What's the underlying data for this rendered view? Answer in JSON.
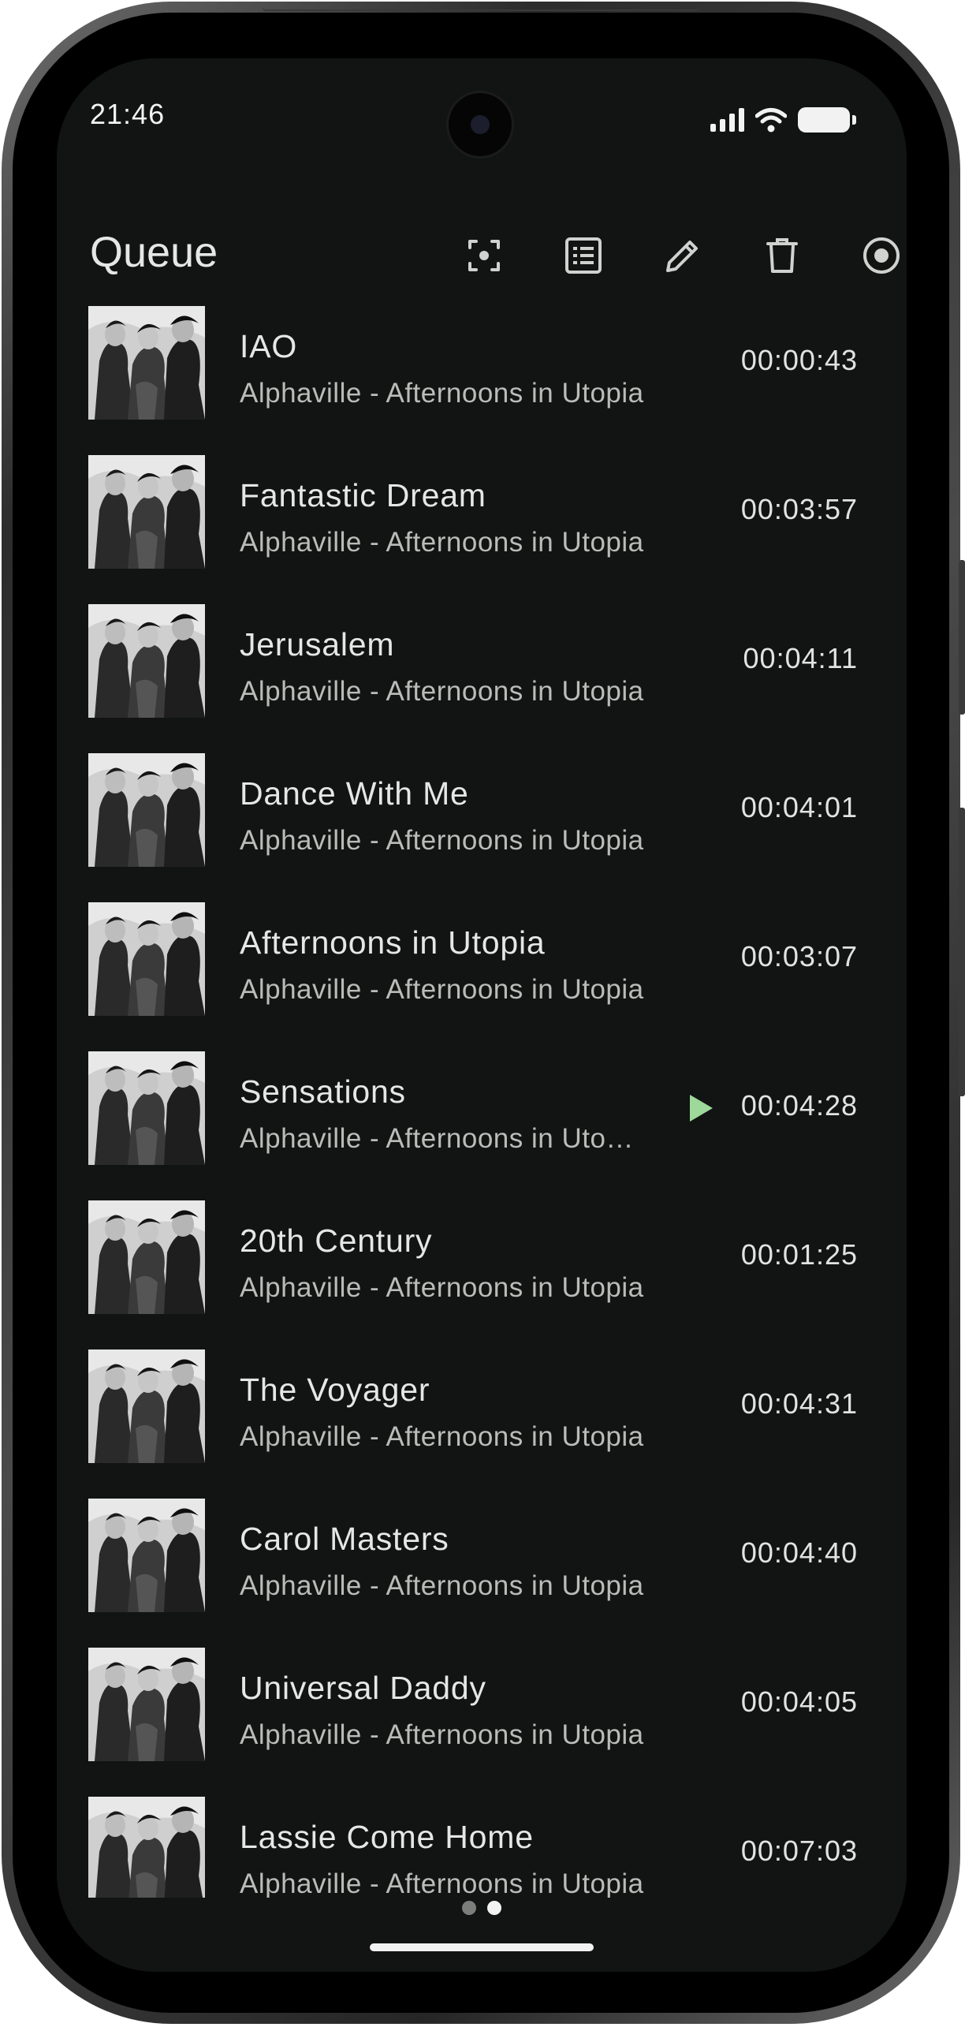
{
  "status_bar": {
    "time": "21:46"
  },
  "app_bar": {
    "title": "Queue",
    "actions": [
      "focus-icon",
      "list-icon",
      "edit-icon",
      "delete-icon",
      "radio-icon"
    ]
  },
  "tracks": [
    {
      "title": "IAO",
      "subtitle": "Alphaville - Afternoons in Utopia",
      "duration": "00:00:43",
      "playing": false
    },
    {
      "title": "Fantastic Dream",
      "subtitle": "Alphaville - Afternoons in Utopia",
      "duration": "00:03:57",
      "playing": false
    },
    {
      "title": "Jerusalem",
      "subtitle": "Alphaville - Afternoons in Utopia",
      "duration": "00:04:11",
      "playing": false
    },
    {
      "title": "Dance With Me",
      "subtitle": "Alphaville - Afternoons in Utopia",
      "duration": "00:04:01",
      "playing": false
    },
    {
      "title": "Afternoons in Utopia",
      "subtitle": "Alphaville - Afternoons in Utopia",
      "duration": "00:03:07",
      "playing": false
    },
    {
      "title": "Sensations",
      "subtitle": "Alphaville - Afternoons in Utopia",
      "duration": "00:04:28",
      "playing": true
    },
    {
      "title": "20th Century",
      "subtitle": "Alphaville - Afternoons in Utopia",
      "duration": "00:01:25",
      "playing": false
    },
    {
      "title": "The Voyager",
      "subtitle": "Alphaville - Afternoons in Utopia",
      "duration": "00:04:31",
      "playing": false
    },
    {
      "title": "Carol Masters",
      "subtitle": "Alphaville - Afternoons in Utopia",
      "duration": "00:04:40",
      "playing": false
    },
    {
      "title": "Universal Daddy",
      "subtitle": "Alphaville - Afternoons in Utopia",
      "duration": "00:04:05",
      "playing": false
    },
    {
      "title": "Lassie Come Home",
      "subtitle": "Alphaville - Afternoons in Utopia",
      "duration": "00:07:03",
      "playing": false
    }
  ],
  "pager": {
    "pages": 2,
    "active": 2
  },
  "colors": {
    "background": "#111412",
    "text_primary": "#e6e6e6",
    "text_secondary": "#b9bcb8",
    "accent": "#9ed89a"
  }
}
